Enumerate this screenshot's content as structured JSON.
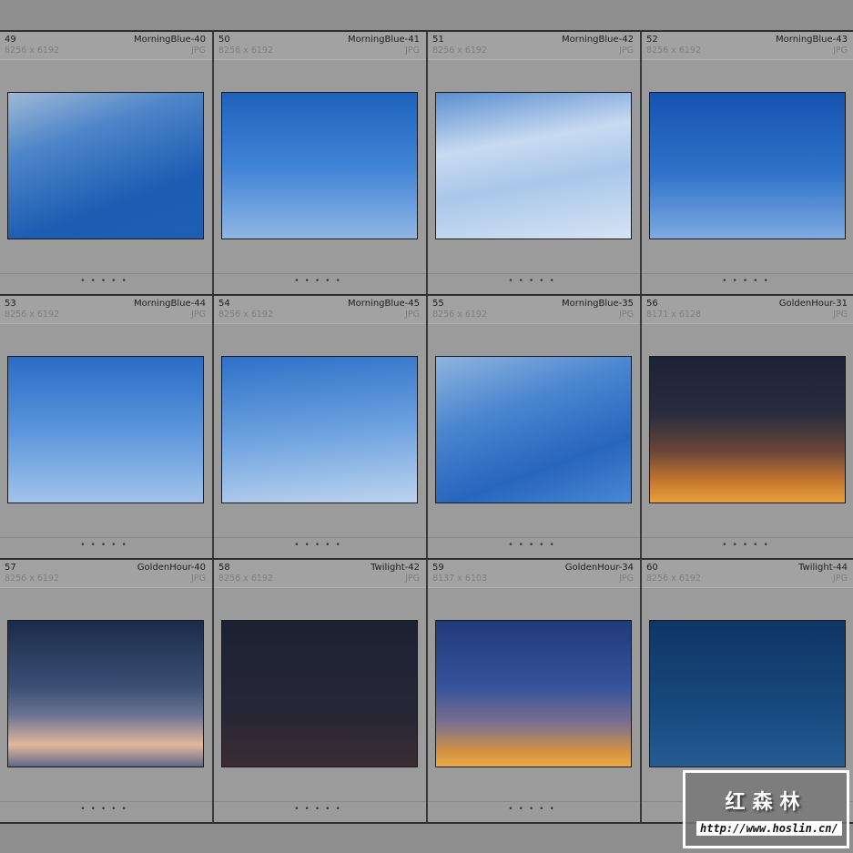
{
  "cells": [
    {
      "index": "49",
      "name": "MorningBlue-40",
      "dims": "8256 x 6192",
      "format": "JPG",
      "bg": "linear-gradient(160deg,#9fb9d8 0%,#4f86c9 30%,#1c5cb2 70%,#1e5fb5 100%)"
    },
    {
      "index": "50",
      "name": "MorningBlue-41",
      "dims": "8256 x 6192",
      "format": "JPG",
      "bg": "linear-gradient(180deg,#1f62bd 0%,#3f82d5 50%,#8fb6e3 100%)"
    },
    {
      "index": "51",
      "name": "MorningBlue-42",
      "dims": "8256 x 6192",
      "format": "JPG",
      "bg": "linear-gradient(170deg,#5c8fd0 0%,#c8daf1 35%,#a9c7ea 60%,#d5e3f3 100%)"
    },
    {
      "index": "52",
      "name": "MorningBlue-43",
      "dims": "8256 x 6192",
      "format": "JPG",
      "bg": "linear-gradient(180deg,#1553b0 0%,#2f72c9 55%,#7eaae0 100%)"
    },
    {
      "index": "53",
      "name": "MorningBlue-44",
      "dims": "8256 x 6192",
      "format": "JPG",
      "bg": "linear-gradient(180deg,#2a6cc6 0%,#5a95db 50%,#a2c3ea 100%)"
    },
    {
      "index": "54",
      "name": "MorningBlue-45",
      "dims": "8256 x 6192",
      "format": "JPG",
      "bg": "linear-gradient(175deg,#2f70c8 0%,#6aa0de 50%,#bcd3ef 100%)"
    },
    {
      "index": "55",
      "name": "MorningBlue-35",
      "dims": "8256 x 6192",
      "format": "JPG",
      "bg": "linear-gradient(160deg,#8fb4df 0%,#4b86d0 35%,#2865bd 70%,#4a88d3 100%)"
    },
    {
      "index": "56",
      "name": "GoldenHour-31",
      "dims": "8171 x 6128",
      "format": "JPG",
      "bg": "linear-gradient(180deg,#1c2236 0%,#2b2c3e 40%,#6a4638 65%,#c4772e 85%,#e9a03b 100%)"
    },
    {
      "index": "57",
      "name": "GoldenHour-40",
      "dims": "8256 x 6192",
      "format": "JPG",
      "bg": "linear-gradient(180deg,#1b2b4a 0%,#3a4f74 45%,#6c7492 65%,#e2b79c 85%,#5d6a8a 100%)"
    },
    {
      "index": "58",
      "name": "Twilight-42",
      "dims": "8256 x 6192",
      "format": "JPG",
      "bg": "linear-gradient(180deg,#1c2233 0%,#262636 60%,#3a2c32 100%)"
    },
    {
      "index": "59",
      "name": "GoldenHour-34",
      "dims": "8137 x 6103",
      "format": "JPG",
      "bg": "linear-gradient(180deg,#213a7a 0%,#35539a 45%,#7a6f8e 70%,#d5933f 90%,#e9aa48 100%)"
    },
    {
      "index": "60",
      "name": "Twilight-44",
      "dims": "8256 x 6192",
      "format": "JPG",
      "bg": "linear-gradient(180deg,#0f3565 0%,#17497e 60%,#235c93 100%)"
    }
  ],
  "dots": "•••••",
  "watermark": {
    "title": "红森林",
    "url": "http://www.hoslin.cn/"
  }
}
